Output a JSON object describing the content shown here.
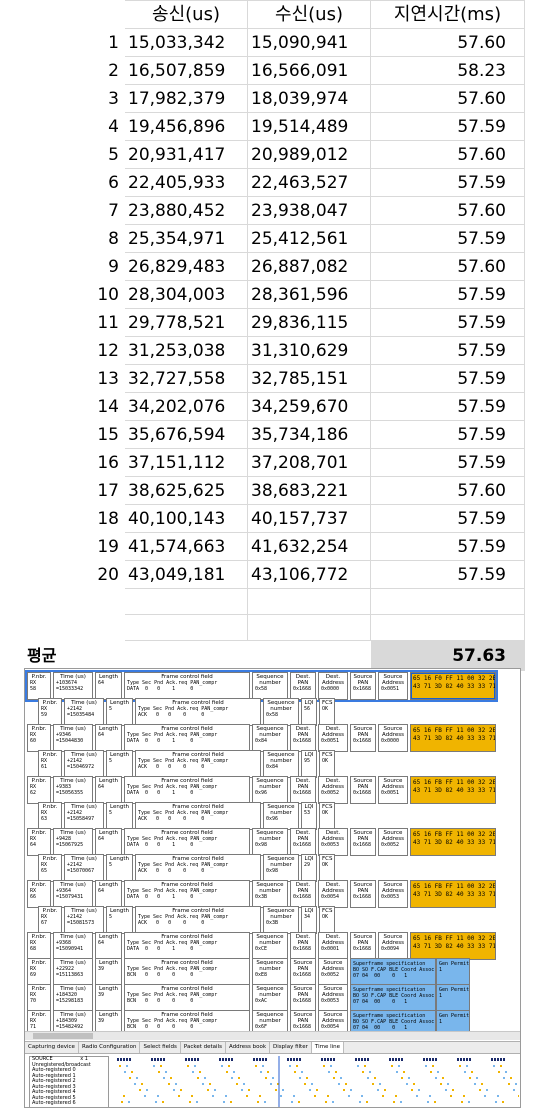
{
  "sheet": {
    "headers": {
      "sent": "송신(us)",
      "received": "수신(us)",
      "latency": "지연시간(ms)"
    },
    "rows": [
      {
        "idx": "1",
        "sent": "15,033,342",
        "received": "15,090,941",
        "latency": "57.60"
      },
      {
        "idx": "2",
        "sent": "16,507,859",
        "received": "16,566,091",
        "latency": "58.23"
      },
      {
        "idx": "3",
        "sent": "17,982,379",
        "received": "18,039,974",
        "latency": "57.60"
      },
      {
        "idx": "4",
        "sent": "19,456,896",
        "received": "19,514,489",
        "latency": "57.59"
      },
      {
        "idx": "5",
        "sent": "20,931,417",
        "received": "20,989,012",
        "latency": "57.60"
      },
      {
        "idx": "6",
        "sent": "22,405,933",
        "received": "22,463,527",
        "latency": "57.59"
      },
      {
        "idx": "7",
        "sent": "23,880,452",
        "received": "23,938,047",
        "latency": "57.60"
      },
      {
        "idx": "8",
        "sent": "25,354,971",
        "received": "25,412,561",
        "latency": "57.59"
      },
      {
        "idx": "9",
        "sent": "26,829,483",
        "received": "26,887,082",
        "latency": "57.60"
      },
      {
        "idx": "10",
        "sent": "28,304,003",
        "received": "28,361,596",
        "latency": "57.59"
      },
      {
        "idx": "11",
        "sent": "29,778,521",
        "received": "29,836,115",
        "latency": "57.59"
      },
      {
        "idx": "12",
        "sent": "31,253,038",
        "received": "31,310,629",
        "latency": "57.59"
      },
      {
        "idx": "13",
        "sent": "32,727,558",
        "received": "32,785,151",
        "latency": "57.59"
      },
      {
        "idx": "14",
        "sent": "34,202,076",
        "received": "34,259,670",
        "latency": "57.59"
      },
      {
        "idx": "15",
        "sent": "35,676,594",
        "received": "35,734,186",
        "latency": "57.59"
      },
      {
        "idx": "16",
        "sent": "37,151,112",
        "received": "37,208,701",
        "latency": "57.59"
      },
      {
        "idx": "17",
        "sent": "38,625,625",
        "received": "38,683,221",
        "latency": "57.60"
      },
      {
        "idx": "18",
        "sent": "40,100,143",
        "received": "40,157,737",
        "latency": "57.59"
      },
      {
        "idx": "19",
        "sent": "41,574,663",
        "received": "41,632,254",
        "latency": "57.59"
      },
      {
        "idx": "20",
        "sent": "43,049,181",
        "received": "43,106,772",
        "latency": "57.59"
      }
    ],
    "average_label": "평균",
    "average_value": "57.63"
  },
  "sniffer": {
    "field_headers": {
      "pnbr": "P.nbr.",
      "time": "Time (us)",
      "length": "Length",
      "fcf": "Frame control field",
      "fcf_sub": "Type Sec Pnd Ack.req PAN_compr",
      "seq": "Sequence number",
      "dest_pan": "Dest. PAN",
      "dest_addr": "Dest. Address",
      "src_pan": "Source PAN",
      "src_addr": "Source Address",
      "lqi": "LQI",
      "fcs": "FCS",
      "superframe": "Superframe specification",
      "superframe_sub": "BO SO F.CAP BLE Coord Assoc",
      "gts": "Gen Permit"
    },
    "packets": [
      {
        "pnbr": "RX\n58",
        "time": "+103674\n=15033342",
        "length": "64",
        "fcf": "DATA  0   0    1     0",
        "seq": "0x58",
        "dest_pan": "0x1668",
        "dest_addr": "0x0000",
        "src_pan": "0x1668",
        "src_addr": "0x0051",
        "hex": "65 16 F0 FF 11 00 32 2E\n43 71 3D 82 40 33 33 71",
        "kind": "data"
      },
      {
        "pnbr": "RX\n59",
        "time": "+2142\n=15035484",
        "length": "5",
        "fcf": "ACK   0   0    0     0",
        "seq": "0x58",
        "lqi": "56",
        "fcs": "OK",
        "kind": "ack"
      },
      {
        "pnbr": "RX\n60",
        "time": "+9346\n=15044830",
        "length": "64",
        "fcf": "DATA  0   0    1     0",
        "seq": "0x84",
        "dest_pan": "0x1668",
        "dest_addr": "0x0051",
        "src_pan": "0x1668",
        "src_addr": "0x0000",
        "hex": "65 16 FB FF 11 00 32 2E\n43 71 3D 82 40 33 33 71",
        "kind": "data"
      },
      {
        "pnbr": "RX\n61",
        "time": "+2142\n=15046972",
        "length": "5",
        "fcf": "ACK   0   0    0     0",
        "seq": "0x84",
        "lqi": "95",
        "fcs": "OK",
        "kind": "ack"
      },
      {
        "pnbr": "RX\n62",
        "time": "+9383\n=15056355",
        "length": "64",
        "fcf": "DATA  0   0    1     0",
        "seq": "0x96",
        "dest_pan": "0x1668",
        "dest_addr": "0x0052",
        "src_pan": "0x1668",
        "src_addr": "0x0051",
        "hex": "65 16 FB FF 11 00 32 2E\n43 71 3D 82 40 33 33 71",
        "kind": "data"
      },
      {
        "pnbr": "RX\n63",
        "time": "+2142\n=15058497",
        "length": "5",
        "fcf": "ACK   0   0    0     0",
        "seq": "0x96",
        "lqi": "53",
        "fcs": "OK",
        "kind": "ack"
      },
      {
        "pnbr": "RX\n64",
        "time": "+9428\n=15067925",
        "length": "64",
        "fcf": "DATA  0   0    1     0",
        "seq": "0x98",
        "dest_pan": "0x1668",
        "dest_addr": "0x0053",
        "src_pan": "0x1668",
        "src_addr": "0x0052",
        "hex": "65 16 FB FF 11 00 32 2E\n43 71 3D 82 40 33 33 71",
        "kind": "data"
      },
      {
        "pnbr": "RX\n65",
        "time": "+2142\n=15070067",
        "length": "5",
        "fcf": "ACK   0   0    0     0",
        "seq": "0x98",
        "lqi": "29",
        "fcs": "OK",
        "kind": "ack"
      },
      {
        "pnbr": "RX\n66",
        "time": "+9364\n=15079431",
        "length": "64",
        "fcf": "DATA  0   0    1     0",
        "seq": "0x3B",
        "dest_pan": "0x1668",
        "dest_addr": "0x0054",
        "src_pan": "0x1668",
        "src_addr": "0x0053",
        "hex": "65 16 FB FF 11 00 32 2E\n43 71 3D 82 40 33 33 71",
        "kind": "data"
      },
      {
        "pnbr": "RX\n67",
        "time": "+2142\n=15081573",
        "length": "5",
        "fcf": "ACK   0   0    0     0",
        "seq": "0x3B",
        "lqi": "34",
        "fcs": "OK",
        "kind": "ack"
      },
      {
        "pnbr": "RX\n68",
        "time": "+9368\n=15090941",
        "length": "64",
        "fcf": "DATA  0   0    1     0",
        "seq": "0xCE",
        "dest_pan": "0x1668",
        "dest_addr": "0x0001",
        "src_pan": "0x1668",
        "src_addr": "0x0094",
        "hex": "65 16 FB FF 11 00 32 2E\n43 71 3D 82 40 33 33 71",
        "kind": "data"
      },
      {
        "pnbr": "RX\n69",
        "time": "+22922\n=15113863",
        "length": "39",
        "fcf": "BCN   0   0    0     0",
        "seq": "0xE8",
        "src_pan": "0x1668",
        "src_addr": "0x0052",
        "sf": "07 04  00    0   1",
        "gts": "1",
        "kind": "bcn"
      },
      {
        "pnbr": "RX\n70",
        "time": "+184320\n=15298183",
        "length": "39",
        "fcf": "BCN   0   0    0     0",
        "seq": "0xAC",
        "src_pan": "0x1668",
        "src_addr": "0x0053",
        "sf": "07 04  00    0   1",
        "gts": "1",
        "kind": "bcn"
      },
      {
        "pnbr": "RX\n71",
        "time": "+184309\n=15482492",
        "length": "39",
        "fcf": "BCN   0   0    0     0",
        "seq": "0x6F",
        "src_pan": "0x1668",
        "src_addr": "0x0054",
        "sf": "07 04  00    0   1",
        "gts": "1",
        "kind": "bcn"
      }
    ],
    "tabs": [
      "Capturing device",
      "Radio Configuration",
      "Select fields",
      "Packet details",
      "Address book",
      "Display filter",
      "Time line"
    ],
    "active_tab": "Time line",
    "timeline": {
      "header_label": "SOURCE",
      "scale_label": "x 1",
      "rows": [
        "Unregistered/broadcast",
        "Auto-registered 0",
        "Auto-registered 1",
        "Auto-registered 2",
        "Auto-registered 3",
        "Auto-registered 4",
        "Auto-registered 5",
        "Auto-registered 6"
      ]
    },
    "colors": {
      "data_hex": "#f0b400",
      "beacon_hex": "#79b6ec",
      "selection": "#3a7be0"
    }
  }
}
